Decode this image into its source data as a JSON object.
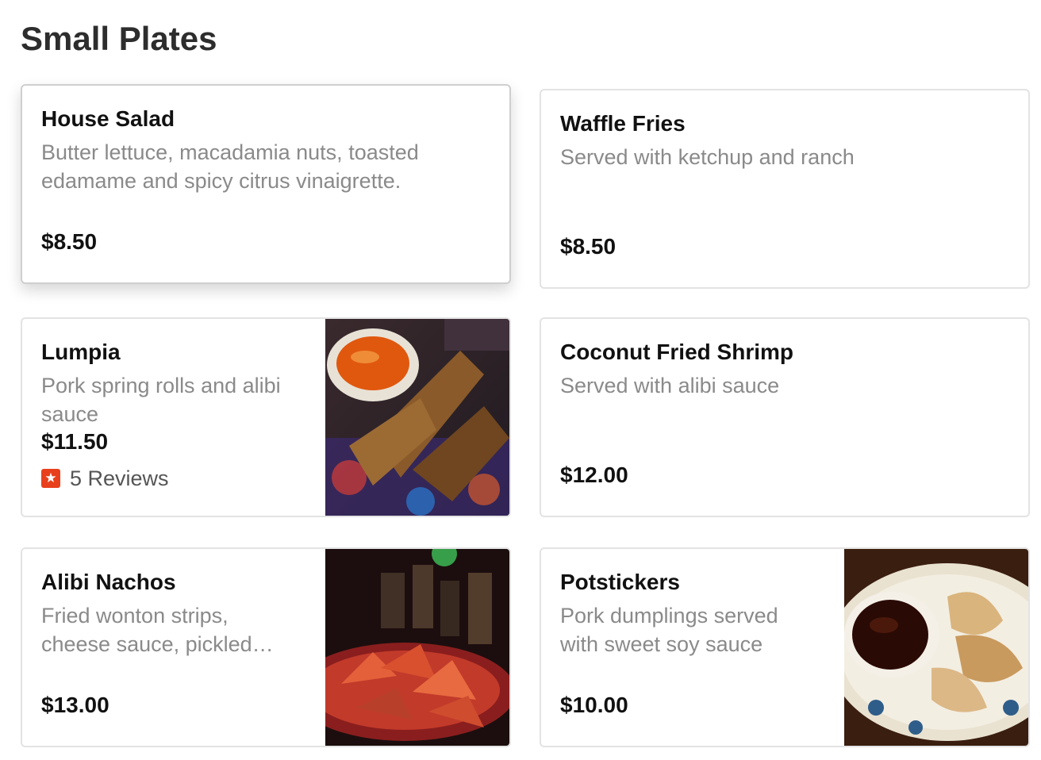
{
  "section": {
    "title": "Small Plates"
  },
  "items": [
    {
      "name": "House Salad",
      "description_lines": [
        "Butter lettuce, macadamia nuts, toasted",
        "edamame and spicy citrus vinaigrette."
      ],
      "price": "$8.50"
    },
    {
      "name": "Waffle Fries",
      "description_lines": [
        "Served with ketchup and ranch"
      ],
      "price": "$8.50"
    },
    {
      "name": "Lumpia",
      "description_lines": [
        "Pork spring rolls and alibi",
        "sauce"
      ],
      "price": "$11.50",
      "reviews": "5 Reviews",
      "photo_icon": "lumpia-photo"
    },
    {
      "name": "Coconut Fried Shrimp",
      "description_lines": [
        "Served with alibi sauce"
      ],
      "price": "$12.00"
    },
    {
      "name": "Alibi Nachos",
      "description_lines": [
        "Fried wonton strips,",
        "cheese sauce, pickled…"
      ],
      "price": "$13.00",
      "photo_icon": "nachos-photo"
    },
    {
      "name": "Potstickers",
      "description_lines": [
        "Pork dumplings served",
        "with sweet soy sauce"
      ],
      "price": "$10.00",
      "photo_icon": "potstickers-photo"
    }
  ],
  "colors": {
    "review_badge": "#e8401c"
  },
  "icons": {
    "review_badge": "star-icon"
  }
}
